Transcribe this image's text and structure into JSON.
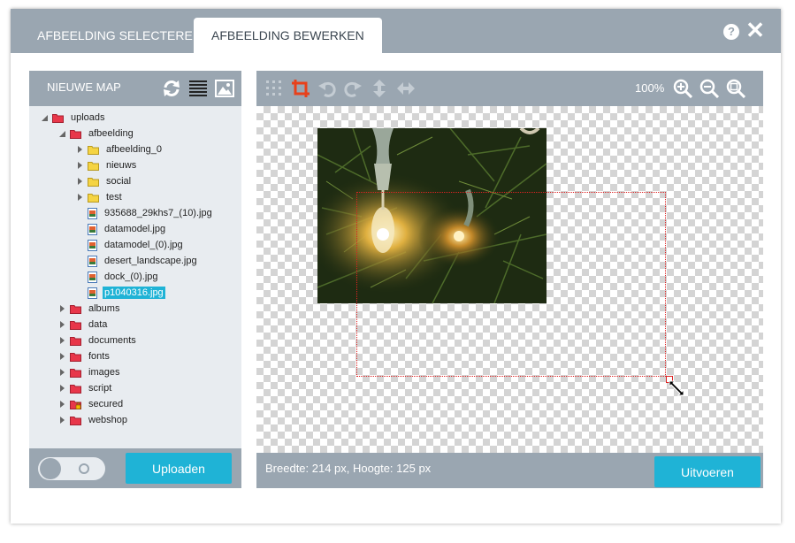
{
  "tabs": [
    {
      "label": "AFBEELDING SELECTEREN"
    },
    {
      "label": "AFBEELDING BEWERKEN"
    }
  ],
  "header": {
    "help_label": "?",
    "close_label": "✕"
  },
  "sidebar": {
    "new_folder_label": "NIEUWE MAP",
    "tree": [
      {
        "label": "uploads",
        "type": "folder",
        "color": "red"
      },
      {
        "label": "afbeelding",
        "type": "folder",
        "color": "red"
      },
      {
        "label": "afbeelding_0",
        "type": "folder",
        "color": "yellow"
      },
      {
        "label": "nieuws",
        "type": "folder",
        "color": "yellow"
      },
      {
        "label": "social",
        "type": "folder",
        "color": "yellow"
      },
      {
        "label": "test",
        "type": "folder",
        "color": "yellow"
      },
      {
        "label": "935688_29khs7_(10).jpg",
        "type": "file"
      },
      {
        "label": "datamodel.jpg",
        "type": "file"
      },
      {
        "label": "datamodel_(0).jpg",
        "type": "file"
      },
      {
        "label": "desert_landscape.jpg",
        "type": "file"
      },
      {
        "label": "dock_(0).jpg",
        "type": "file"
      },
      {
        "label": "p1040316.jpg",
        "type": "file",
        "selected": true
      },
      {
        "label": "albums",
        "type": "folder",
        "color": "red"
      },
      {
        "label": "data",
        "type": "folder",
        "color": "red"
      },
      {
        "label": "documents",
        "type": "folder",
        "color": "red"
      },
      {
        "label": "fonts",
        "type": "folder",
        "color": "red"
      },
      {
        "label": "images",
        "type": "folder",
        "color": "red"
      },
      {
        "label": "script",
        "type": "folder",
        "color": "red"
      },
      {
        "label": "secured",
        "type": "folder",
        "color": "red",
        "locked": true
      },
      {
        "label": "webshop",
        "type": "folder",
        "color": "red"
      }
    ],
    "upload_label": "Uploaden"
  },
  "editor": {
    "zoom": "100%",
    "dimensions_text": "Breedte: 214 px, Hoogte: 125 px",
    "execute_label": "Uitvoeren"
  },
  "colors": {
    "header_gray": "#9aa6b1",
    "accent": "#1fb3d6",
    "crop_tool": "#e8401a",
    "folder_red": "#e8374a",
    "folder_yellow": "#f5d443"
  }
}
